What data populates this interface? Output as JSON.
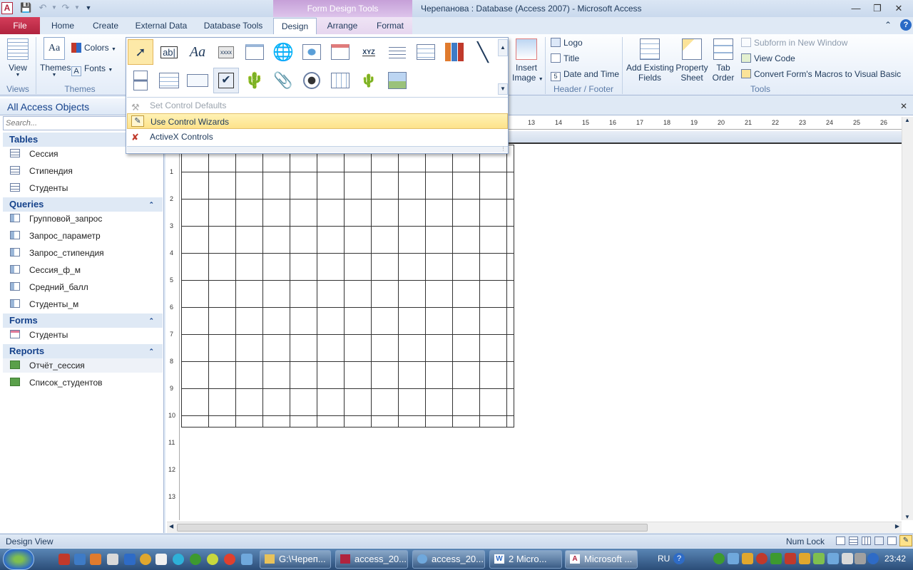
{
  "window": {
    "title": "Черепанова : Database (Access 2007)  -  Microsoft Access",
    "context_tool": "Form Design Tools",
    "help": "?"
  },
  "tabs": {
    "file": "File",
    "home": "Home",
    "create": "Create",
    "external": "External Data",
    "dbtools": "Database Tools",
    "design": "Design",
    "arrange": "Arrange",
    "format": "Format"
  },
  "ribbon": {
    "views": {
      "view": "View",
      "label": "Views"
    },
    "themes": {
      "themes": "Themes",
      "colors": "Colors",
      "fonts": "Fonts",
      "label": "Themes"
    },
    "insert_image": {
      "line1": "Insert",
      "line2": "Image"
    },
    "header_footer": {
      "logo": "Logo",
      "title": "Title",
      "date_time": "Date and Time",
      "label": "Header / Footer"
    },
    "tools": {
      "add_fields_1": "Add Existing",
      "add_fields_2": "Fields",
      "property_1": "Property",
      "property_2": "Sheet",
      "tab_order_1": "Tab",
      "tab_order_2": "Order",
      "subform": "Subform in New Window",
      "view_code": "View Code",
      "convert": "Convert Form's Macros to Visual Basic",
      "label": "Tools"
    }
  },
  "controls_menu": {
    "set_defaults": "Set Control Defaults",
    "use_wizards": "Use Control Wizards",
    "activex": "ActiveX Controls",
    "textbox_glyph": "ab|",
    "label_glyph": "Aa",
    "button_glyph": "xxxx",
    "xyz": "XYZ"
  },
  "nav": {
    "header": "All Access Objects",
    "search_placeholder": "Search...",
    "tables": {
      "label": "Tables",
      "items": [
        "Сессия",
        "Стипендия",
        "Студенты"
      ]
    },
    "queries": {
      "label": "Queries",
      "items": [
        "Групповой_запрос",
        "Запрос_параметр",
        "Запрос_стипендия",
        "Сессия_ф_м",
        "Средний_балл",
        "Студенты_м"
      ]
    },
    "forms": {
      "label": "Forms",
      "items": [
        "Студенты"
      ]
    },
    "reports": {
      "label": "Reports",
      "items": [
        "Отчёт_сессия",
        "Список_студентов"
      ]
    }
  },
  "ruler": {
    "top": [
      "13",
      "14",
      "15",
      "16",
      "17",
      "18",
      "19",
      "20",
      "21",
      "22",
      "23",
      "24",
      "25",
      "26"
    ],
    "left": [
      "1",
      "2",
      "3",
      "4",
      "5",
      "6",
      "7",
      "8",
      "9",
      "10",
      "11",
      "12",
      "13"
    ]
  },
  "status": {
    "left": "Design View",
    "numlock": "Num Lock"
  },
  "taskbar": {
    "buttons": [
      "G:\\Череп...",
      "access_20...",
      "access_20...",
      "2 Micro...",
      "Microsoft ..."
    ],
    "lang": "RU",
    "time": "23:42"
  }
}
